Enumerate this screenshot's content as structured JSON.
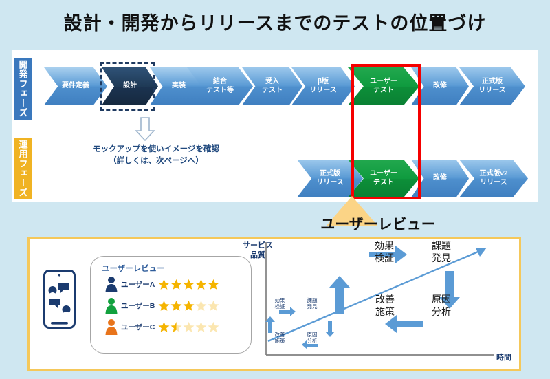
{
  "page": {
    "title": "設計・開発からリリースまでのテストの位置づけ",
    "background_color": "#cfe7f1"
  },
  "phases": {
    "dev_label": "開発フェーズ",
    "ops_label": "運用フェーズ",
    "dev_color": "#3a78bd",
    "ops_color": "#f0b323"
  },
  "dev_flow": [
    {
      "line1": "要件定義",
      "line2": "",
      "style": "light"
    },
    {
      "line1": "設計",
      "line2": "",
      "style": "dark",
      "highlight": "dashed"
    },
    {
      "line1": "実装",
      "line2": "",
      "style": "light"
    },
    {
      "line1": "結合",
      "line2": "テスト等",
      "style": "light"
    },
    {
      "line1": "受入",
      "line2": "テスト",
      "style": "light"
    },
    {
      "line1": "β版",
      "line2": "リリース",
      "style": "light"
    },
    {
      "line1": "ユーザー",
      "line2": "テスト",
      "style": "green",
      "highlight": "red"
    },
    {
      "line1": "改修",
      "line2": "",
      "style": "light"
    },
    {
      "line1": "正式版",
      "line2": "リリース",
      "style": "light"
    }
  ],
  "ops_flow": [
    {
      "line1": "正式版",
      "line2": "リリース",
      "style": "light"
    },
    {
      "line1": "ユーザー",
      "line2": "テスト",
      "style": "green",
      "highlight": "red"
    },
    {
      "line1": "改修",
      "line2": "",
      "style": "light"
    },
    {
      "line1": "正式版v2",
      "line2": "リリース",
      "style": "light"
    }
  ],
  "mockup_note": {
    "line1": "モックアップを使いイメージを確認",
    "line2": "（詳しくは、次ページへ）"
  },
  "section_heading": "ユーザーレビュー",
  "review": {
    "card_title": "ユーザーレビュー",
    "rows": [
      {
        "name": "ユーザーA",
        "rating": 5,
        "avatar_color": "#1b3b6f"
      },
      {
        "name": "ユーザーB",
        "rating": 3,
        "avatar_color": "#12a13e"
      },
      {
        "name": "ユーザーC",
        "rating": 1.5,
        "avatar_color": "#e8741b"
      }
    ],
    "star_full_color": "#f5b400",
    "star_empty_color": "#fbe6b0"
  },
  "chart_data": {
    "type": "line",
    "title": "",
    "xlabel": "時間",
    "ylabel": "サービス品質",
    "grid": false,
    "legend": "none",
    "series": [
      {
        "name": "サービス品質の向上",
        "x": [
          0,
          1
        ],
        "y": [
          0.12,
          0.92
        ],
        "color": "#5b9bd5"
      }
    ],
    "annotations": [
      {
        "id": "cycle-small",
        "scale": "small",
        "labels": [
          "効果検証",
          "課題発見",
          "原因分析",
          "改善施策"
        ]
      },
      {
        "id": "cycle-large",
        "scale": "large",
        "labels": [
          "効果検証",
          "課題発見",
          "原因分析",
          "改善施策"
        ]
      }
    ],
    "cycle_small": {
      "top_left_l1": "効果",
      "top_left_l2": "検証",
      "top_right_l1": "課題",
      "top_right_l2": "発見",
      "bottom_right_l1": "原因",
      "bottom_right_l2": "分析",
      "bottom_left_l1": "改善",
      "bottom_left_l2": "施策"
    },
    "cycle_large": {
      "top_left_l1": "効果",
      "top_left_l2": "検証",
      "top_right_l1": "課題",
      "top_right_l2": "発見",
      "bottom_right_l1": "原因",
      "bottom_right_l2": "分析",
      "bottom_left_l1": "改善",
      "bottom_left_l2": "施策"
    }
  }
}
